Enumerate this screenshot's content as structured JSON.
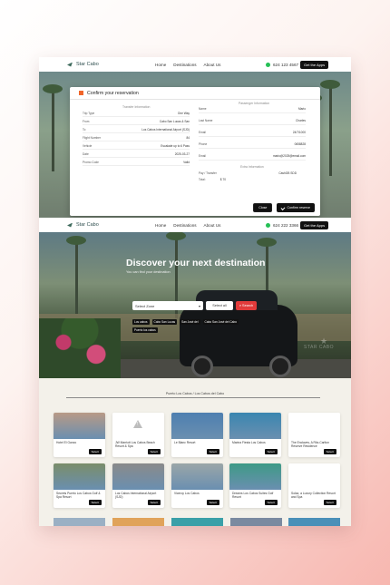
{
  "brand": {
    "name": "Star Cabo"
  },
  "nav": {
    "links": [
      "Home",
      "Destinations",
      "About Us"
    ],
    "phone": "624 123 4567",
    "cta": "Get the Apps"
  },
  "nav2": {
    "links": [
      "Home",
      "Destinations",
      "About Us"
    ],
    "phone": "624 222 3366",
    "cta": "Get the Apps"
  },
  "modal": {
    "title": "Confirm your reservation",
    "transfer_title": "Transfer Information",
    "passenger_title": "Passenger Information",
    "transfer_rows": [
      {
        "label": "Trip Type",
        "value": "One Way"
      },
      {
        "label": "From",
        "value": "Cabo San Lucas & San"
      },
      {
        "label": "To",
        "value": "Los Cabos International Airport (SJD)"
      },
      {
        "label": "Flight Number",
        "value": "84"
      },
      {
        "label": "Vehicle",
        "value": "Escalade up to 6 Pass"
      },
      {
        "label": "Date",
        "value": "2025-03-27"
      },
      {
        "label": "Promo Code",
        "value": "Valid"
      }
    ],
    "passenger_rows": [
      {
        "label": "Name",
        "value": "Mario"
      },
      {
        "label": "Last Name",
        "value": "Charles"
      },
      {
        "label": "Email",
        "value": "24/7/1000"
      },
      {
        "label": "Phone",
        "value": "0658828"
      },
      {
        "label": "Email",
        "value": "mario@2025@email.com"
      }
    ],
    "extra_title": "Extra Information",
    "pay_label": "Pay / Transfer",
    "pay_value": "CashGB SDD",
    "total_label": "Total:",
    "total_value": "$ 70",
    "discount_value": "$ 76",
    "close_label": "Close",
    "confirm_label": "Confirm reserve"
  },
  "hero": {
    "title": "Discover your next destination",
    "subtitle": "You can find your destination",
    "zone_placeholder": "Select Zone",
    "select_all": "Select all",
    "search": "Search",
    "chips": [
      "Los cabos",
      "Cabo San Lucas",
      "San José del",
      "Cabo San José del Cabo",
      "Puerto los cabos"
    ],
    "watermark": "STAR CABO"
  },
  "section": {
    "title": "Puerto Los Cabos / Los Cabos del Cabo"
  },
  "hotels": [
    {
      "name": "Hotel El Ganzo",
      "img": "#b89a86"
    },
    {
      "name": "JW Marriott Los Cabos Beach Resort & Spa",
      "img": "#ffffff"
    },
    {
      "name": "Le Blanc Resort",
      "img": "#4e7fb0"
    },
    {
      "name": "Marina Fiesta Los Cabos",
      "img": "#3a86b0"
    },
    {
      "name": "The Enclaves, A Ritz-Carlton Reserve Residence",
      "img": "#ffffff"
    },
    {
      "name": "Secrets Puerto Los Cabos Golf & Spa Resort",
      "img": "#7a8d6a"
    },
    {
      "name": "Los Cabos International Airport (SJD)",
      "img": "#8a8a8a"
    },
    {
      "name": "Viceroy Los Cabos",
      "img": "#9ba6a8"
    },
    {
      "name": "Dreams Los Cabos Suites Golf Resort",
      "img": "#3e9a86"
    },
    {
      "name": "Solaz, a Luxury Collection Resort and Spa",
      "img": "#ffffff"
    }
  ],
  "select_label": "Select"
}
